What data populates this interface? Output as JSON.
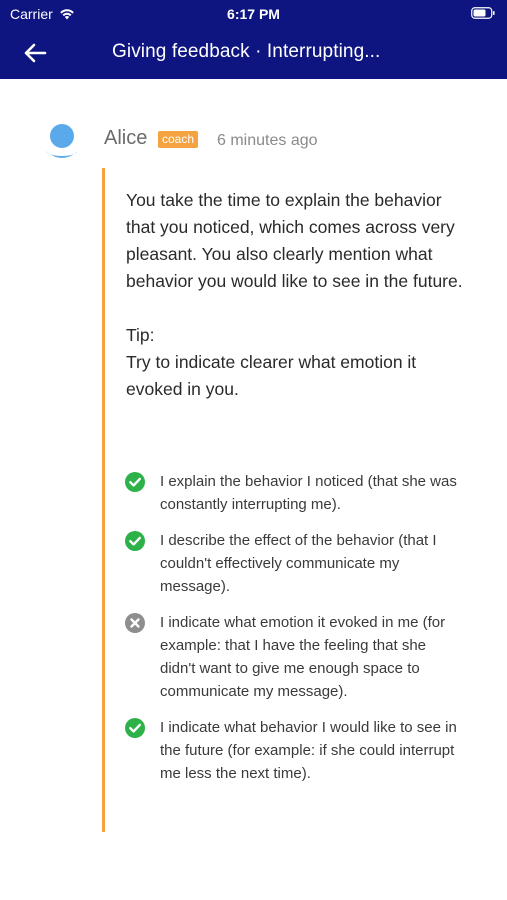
{
  "status_bar": {
    "carrier": "Carrier",
    "time": "6:17 PM"
  },
  "nav": {
    "title": "Giving feedback · Interrupting..."
  },
  "message": {
    "author": "Alice",
    "role": "coach",
    "timestamp": "6 minutes ago",
    "paragraph": "You take the time to explain the behavior that you noticed, which comes across very pleasant. You also clearly mention what behavior you would like to see in the future.",
    "tip_label": "Tip:",
    "tip_text": "Try to indicate clearer what emotion it evoked in you."
  },
  "checklist": [
    {
      "text": "I explain the behavior I noticed (that she was constantly interrupting me).",
      "status": "done"
    },
    {
      "text": "I describe the effect of the behavior (that I couldn't effectively communicate my message).",
      "status": "done"
    },
    {
      "text": "I indicate what emotion it evoked in me (for example: that I have the feeling that she didn't want to give me enough space to communicate my message).",
      "status": "missed"
    },
    {
      "text": "I indicate what behavior I would like to see in the future (for example: if she could interrupt me less the next time).",
      "status": "done"
    }
  ],
  "colors": {
    "header_bg": "#0f1580",
    "accent": "#f4a340",
    "success": "#2db24a",
    "missed": "#8e8e8e",
    "avatar": "#5aa9ea"
  },
  "icons": {
    "back": "arrow-left-icon",
    "wifi": "wifi-icon",
    "battery": "battery-icon",
    "avatar": "user-avatar-icon",
    "done": "check-circle-icon",
    "missed": "x-circle-icon"
  }
}
